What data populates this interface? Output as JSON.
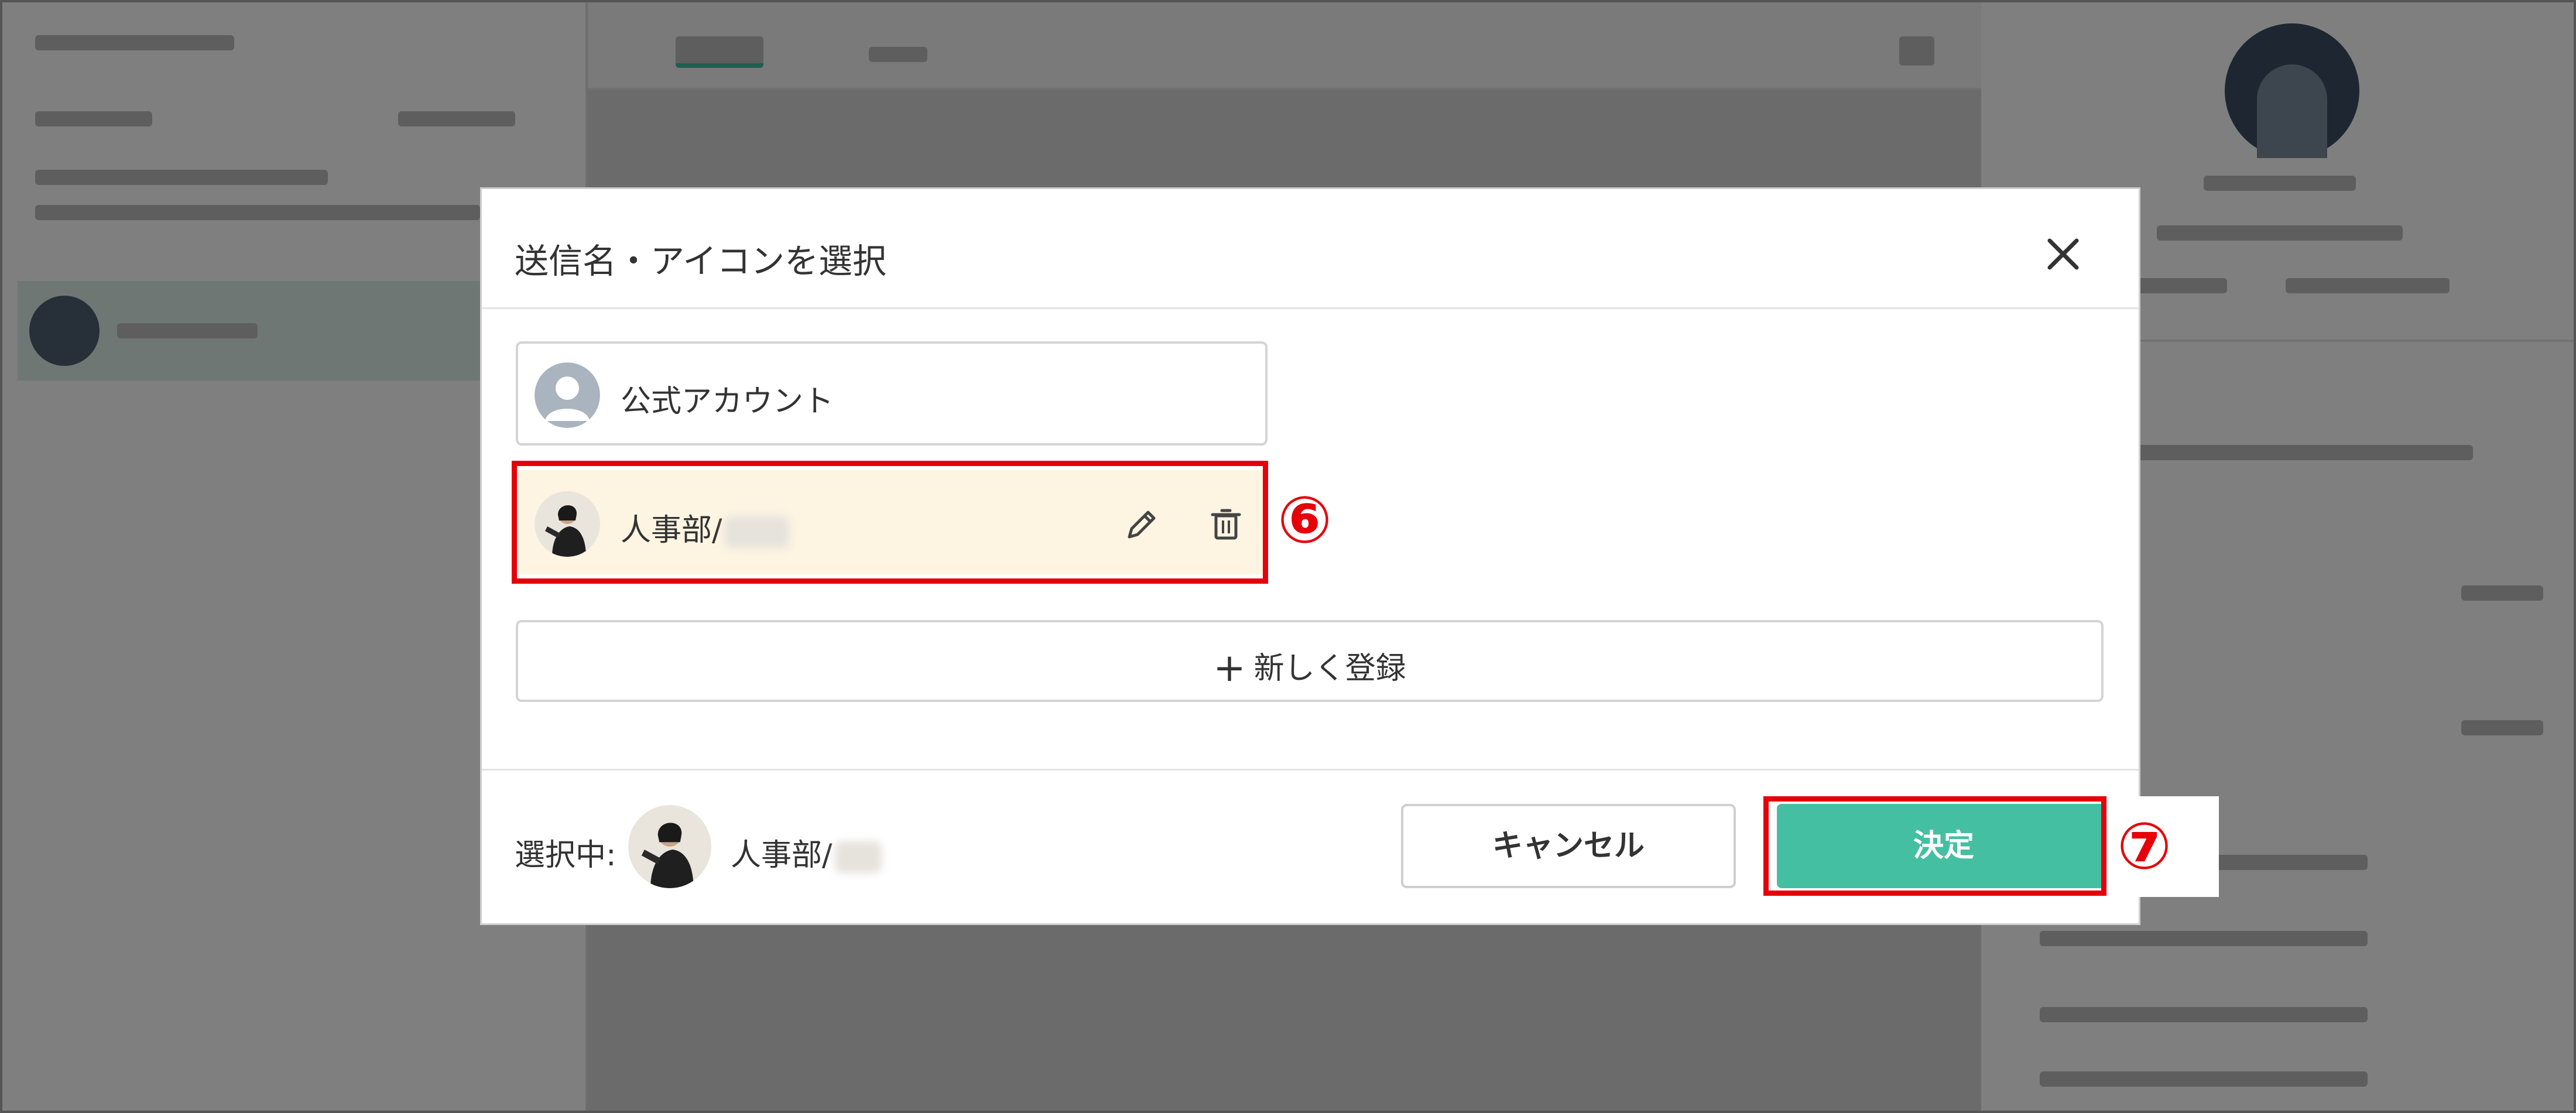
{
  "dialog": {
    "title": "送信名・アイコンを選択",
    "close_icon": "close-icon",
    "options": [
      {
        "label": "公式アカウント",
        "avatar": "default-user-avatar",
        "selected": false
      },
      {
        "label": "人事部/",
        "avatar": "person-photo-avatar",
        "selected": true,
        "edit_icon": "pencil-icon",
        "delete_icon": "trash-icon"
      }
    ],
    "add_button": {
      "plus": "+",
      "label": "新しく登録"
    },
    "footer": {
      "selected_label": "選択中:",
      "selected_name": "人事部/",
      "cancel_label": "キャンセル",
      "confirm_label": "決定"
    }
  },
  "annotations": {
    "step_6": "⑥",
    "step_7": "⑦",
    "highlight_color": "#e6000a"
  },
  "colors": {
    "primary": "#45bfa1",
    "selected_bg": "#fdf4e2",
    "overlay": "rgba(0,0,0,0.5)"
  }
}
